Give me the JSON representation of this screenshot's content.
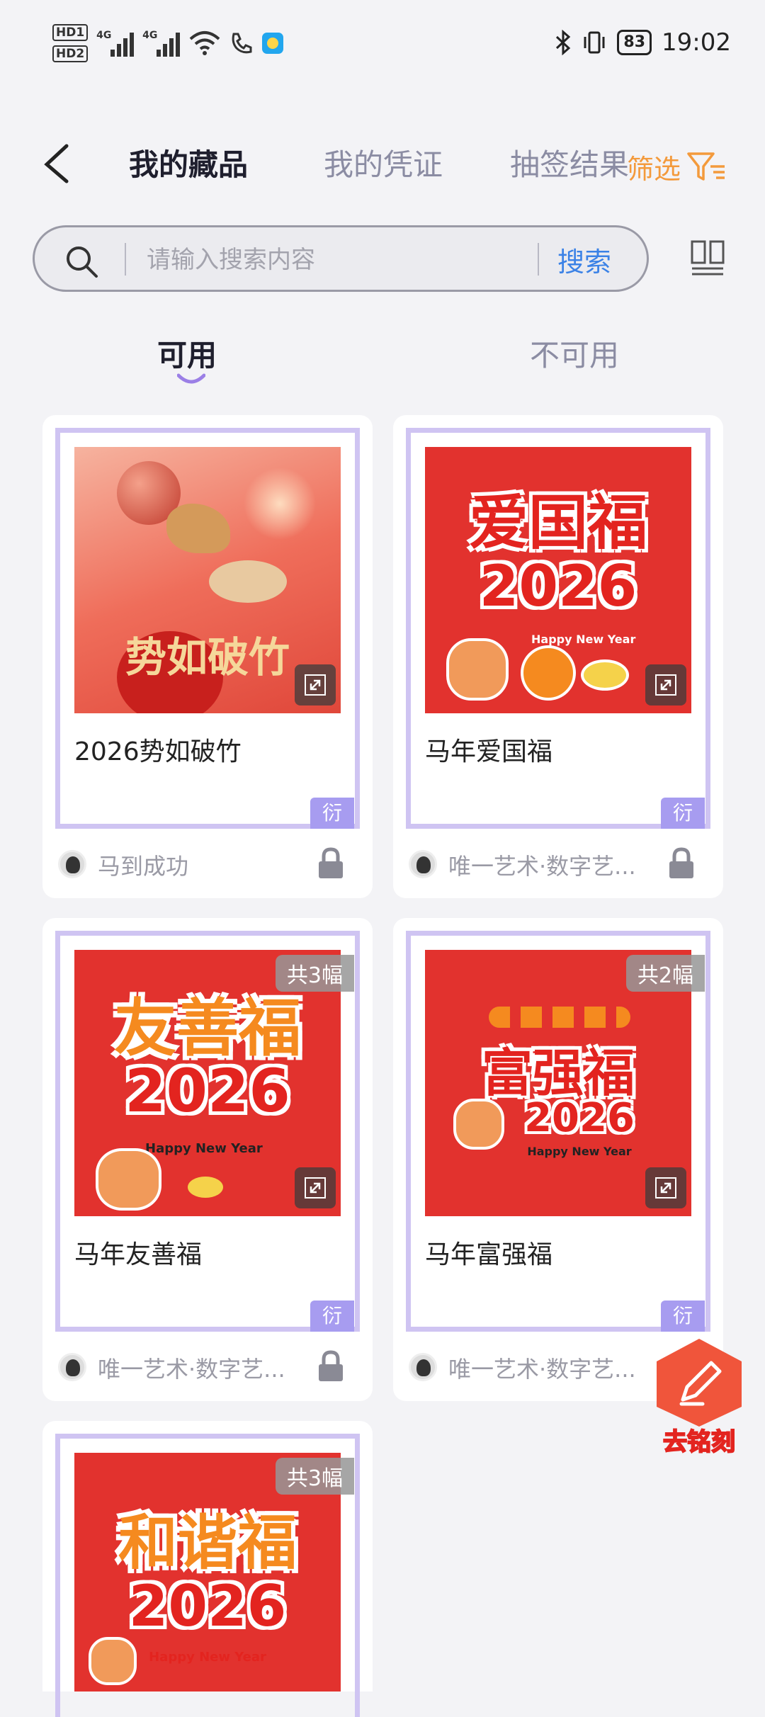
{
  "status_bar": {
    "hd1": "HD1",
    "hd2": "HD2",
    "net1": "4G",
    "net2": "4G",
    "battery": "83",
    "time": "19:02"
  },
  "header": {
    "tabs": [
      {
        "label": "我的藏品",
        "active": true
      },
      {
        "label": "我的凭证",
        "active": false
      },
      {
        "label": "抽签结果",
        "active": false
      }
    ],
    "filter_label": "筛选"
  },
  "search": {
    "placeholder": "请输入搜索内容",
    "button_label": "搜索"
  },
  "sub_tabs": {
    "available": "可用",
    "unavailable": "不可用"
  },
  "cards": [
    {
      "title": "2026势如破竹",
      "tag": "衍",
      "owner": "马到成功",
      "art_text": "势如破竹"
    },
    {
      "title": "马年爱国福",
      "tag": "衍",
      "owner": "唯一艺术·数字艺...",
      "art_text": "爱国福",
      "art_year": "2026",
      "art_sub": "Happy New Year"
    },
    {
      "title": "马年友善福",
      "tag": "衍",
      "owner": "唯一艺术·数字艺...",
      "count": "共3幅",
      "art_text": "友善福",
      "art_year": "2026",
      "art_sub": "Happy New Year"
    },
    {
      "title": "马年富强福",
      "tag": "衍",
      "owner": "唯一艺术·数字艺...",
      "count": "共2幅",
      "art_text": "富强福",
      "art_year": "2026",
      "art_sub": "Happy New Year"
    },
    {
      "title": "",
      "count": "共3幅",
      "art_text": "和谐福",
      "art_year": "2026",
      "art_sub": "Happy New Year"
    }
  ],
  "fab": {
    "label": "去铭刻"
  },
  "colors": {
    "accent_purple": "#a79cf0",
    "frame_purple": "#cfc4f2",
    "search_blue": "#3b82e6",
    "filter_orange": "#f39a3c"
  }
}
